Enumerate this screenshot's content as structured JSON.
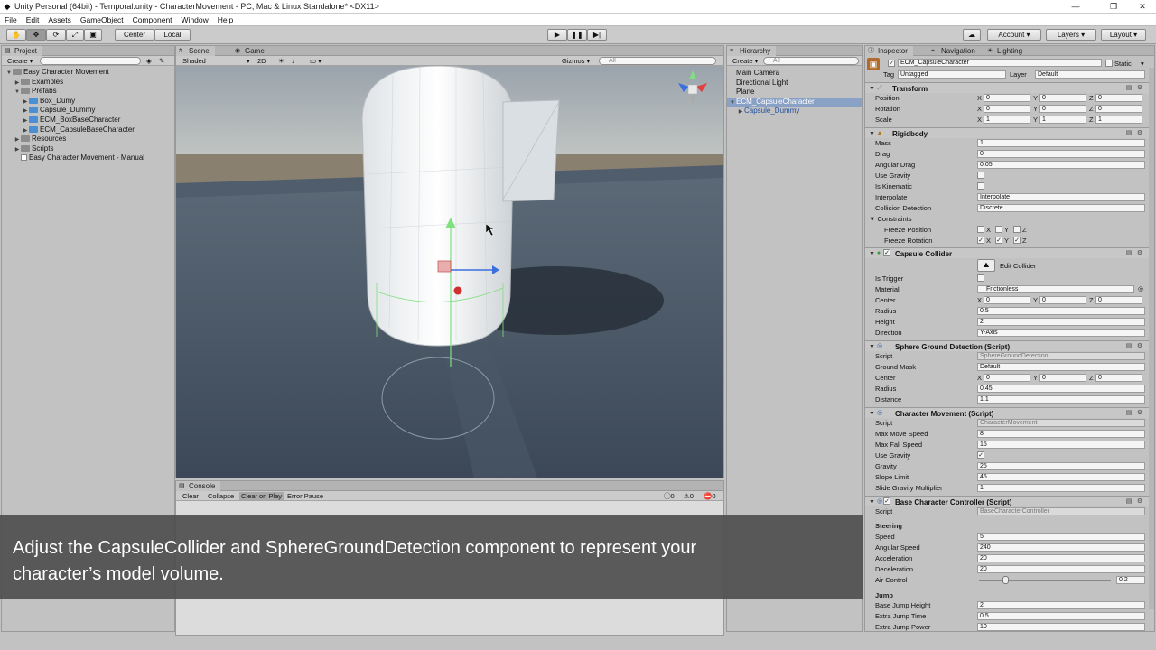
{
  "window": {
    "title": "Unity Personal (64bit) - Temporal.unity - CharacterMovement - PC, Mac & Linux Standalone* <DX11>",
    "min": "—",
    "max": "❐",
    "close": "✕"
  },
  "menu": [
    "File",
    "Edit",
    "Assets",
    "GameObject",
    "Component",
    "Window",
    "Help"
  ],
  "toolbar": {
    "center": "Center",
    "local": "Local",
    "account": "Account",
    "layers": "Layers",
    "layout": "Layout"
  },
  "project": {
    "tab": "Project",
    "create": "Create",
    "items": [
      {
        "label": "Easy Character Movement",
        "indent": 0,
        "arrow": "▼",
        "icon": "folder"
      },
      {
        "label": "Examples",
        "indent": 1,
        "arrow": "▶",
        "icon": "folder"
      },
      {
        "label": "Prefabs",
        "indent": 1,
        "arrow": "▼",
        "icon": "folder"
      },
      {
        "label": "Box_Dumy",
        "indent": 2,
        "arrow": "▶",
        "icon": "prefab"
      },
      {
        "label": "Capsule_Dummy",
        "indent": 2,
        "arrow": "▶",
        "icon": "prefab"
      },
      {
        "label": "ECM_BoxBaseCharacter",
        "indent": 2,
        "arrow": "▶",
        "icon": "prefab"
      },
      {
        "label": "ECM_CapsuleBaseCharacter",
        "indent": 2,
        "arrow": "▶",
        "icon": "prefab"
      },
      {
        "label": "Resources",
        "indent": 1,
        "arrow": "▶",
        "icon": "folder"
      },
      {
        "label": "Scripts",
        "indent": 1,
        "arrow": "▶",
        "icon": "folder"
      },
      {
        "label": "Easy Character Movement - Manual",
        "indent": 1,
        "arrow": "",
        "icon": "doc"
      }
    ]
  },
  "scene": {
    "tab_scene": "Scene",
    "tab_game": "Game",
    "shaded": "Shaded",
    "twod": "2D",
    "gizmos": "Gizmos",
    "search_all": "All"
  },
  "console": {
    "tab": "Console",
    "clear": "Clear",
    "collapse": "Collapse",
    "clear_on_play": "Clear on Play",
    "error_pause": "Error Pause",
    "count_info": "0",
    "count_warn": "0",
    "count_err": "0"
  },
  "hierarchy": {
    "tab": "Hierarchy",
    "create": "Create",
    "search": "All",
    "items": [
      {
        "label": "Main Camera",
        "indent": 0,
        "arrow": "",
        "sel": false,
        "blue": false
      },
      {
        "label": "Directional Light",
        "indent": 0,
        "arrow": "",
        "sel": false,
        "blue": false
      },
      {
        "label": "Plane",
        "indent": 0,
        "arrow": "",
        "sel": false,
        "blue": false
      },
      {
        "label": "ECM_CapsuleCharacter",
        "indent": 0,
        "arrow": "▼",
        "sel": true,
        "blue": false
      },
      {
        "label": "Capsule_Dummy",
        "indent": 1,
        "arrow": "▶",
        "sel": false,
        "blue": true
      }
    ]
  },
  "inspector": {
    "tabs": {
      "inspector": "Inspector",
      "navigation": "Navigation",
      "lighting": "Lighting"
    },
    "object_name": "ECM_CapsuleCharacter",
    "static": "Static",
    "tag_label": "Tag",
    "tag": "Untagged",
    "layer_label": "Layer",
    "layer": "Default",
    "transform": {
      "title": "Transform",
      "position": {
        "label": "Position",
        "x": "0",
        "y": "0",
        "z": "0"
      },
      "rotation": {
        "label": "Rotation",
        "x": "0",
        "y": "0",
        "z": "0"
      },
      "scale": {
        "label": "Scale",
        "x": "1",
        "y": "1",
        "z": "1"
      }
    },
    "rigidbody": {
      "title": "Rigidbody",
      "mass": {
        "label": "Mass",
        "value": "1"
      },
      "drag": {
        "label": "Drag",
        "value": "0"
      },
      "angular_drag": {
        "label": "Angular Drag",
        "value": "0.05"
      },
      "use_gravity": {
        "label": "Use Gravity",
        "checked": ""
      },
      "is_kinematic": {
        "label": "Is Kinematic",
        "checked": ""
      },
      "interpolate": {
        "label": "Interpolate",
        "value": "Interpolate"
      },
      "collision": {
        "label": "Collision Detection",
        "value": "Discrete"
      },
      "constraints": "Constraints",
      "freeze_position": "Freeze Position",
      "freeze_rotation": "Freeze Rotation",
      "axis_x": "X",
      "axis_y": "Y",
      "axis_z": "Z",
      "check": "✓"
    },
    "capsule": {
      "title": "Capsule Collider",
      "edit": "Edit Collider",
      "is_trigger": "Is Trigger",
      "material": {
        "label": "Material",
        "value": "Frictionless"
      },
      "center": {
        "label": "Center",
        "x": "0",
        "y": "0",
        "z": "0"
      },
      "radius": {
        "label": "Radius",
        "value": "0.5"
      },
      "height": {
        "label": "Height",
        "value": "2"
      },
      "direction": {
        "label": "Direction",
        "value": "Y-Axis"
      }
    },
    "sphere": {
      "title": "Sphere Ground Detection (Script)",
      "script": {
        "label": "Script",
        "value": "SphereGroundDetection"
      },
      "ground_mask": {
        "label": "Ground Mask",
        "value": "Default"
      },
      "center": {
        "label": "Center",
        "x": "0",
        "y": "0",
        "z": "0"
      },
      "radius": {
        "label": "Radius",
        "value": "0.45"
      },
      "distance": {
        "label": "Distance",
        "value": "1.1"
      }
    },
    "movement": {
      "title": "Character Movement (Script)",
      "script": {
        "label": "Script",
        "value": "CharacterMovement"
      },
      "max_move_speed": {
        "label": "Max Move Speed",
        "value": "8"
      },
      "max_fall_speed": {
        "label": "Max Fall Speed",
        "value": "15"
      },
      "use_gravity": {
        "label": "Use Gravity",
        "checked": "✓"
      },
      "gravity": {
        "label": "Gravity",
        "value": "25"
      },
      "slope_limit": {
        "label": "Slope Limit",
        "value": "45"
      },
      "slide_gravity": {
        "label": "Slide Gravity Multiplier",
        "value": "1"
      }
    },
    "controller": {
      "title": "Base Character Controller (Script)",
      "script": {
        "label": "Script",
        "value": "BaseCharacterController"
      },
      "steering": "Steering",
      "speed": {
        "label": "Speed",
        "value": "5"
      },
      "angular_speed": {
        "label": "Angular Speed",
        "value": "240"
      },
      "acceleration": {
        "label": "Acceleration",
        "value": "20"
      },
      "deceleration": {
        "label": "Deceleration",
        "value": "20"
      },
      "air_control": {
        "label": "Air Control",
        "value": "0.2",
        "fraction": 0.2
      },
      "jump": "Jump",
      "base_jump_height": {
        "label": "Base Jump Height",
        "value": "2"
      },
      "extra_jump_time": {
        "label": "Extra Jump Time",
        "value": "0.5"
      },
      "extra_jump_power": {
        "label": "Extra Jump Power",
        "value": "10"
      }
    }
  },
  "caption": "Adjust the CapsuleCollider and SphereGroundDetection component to represent your\ncharacter’s model volume."
}
